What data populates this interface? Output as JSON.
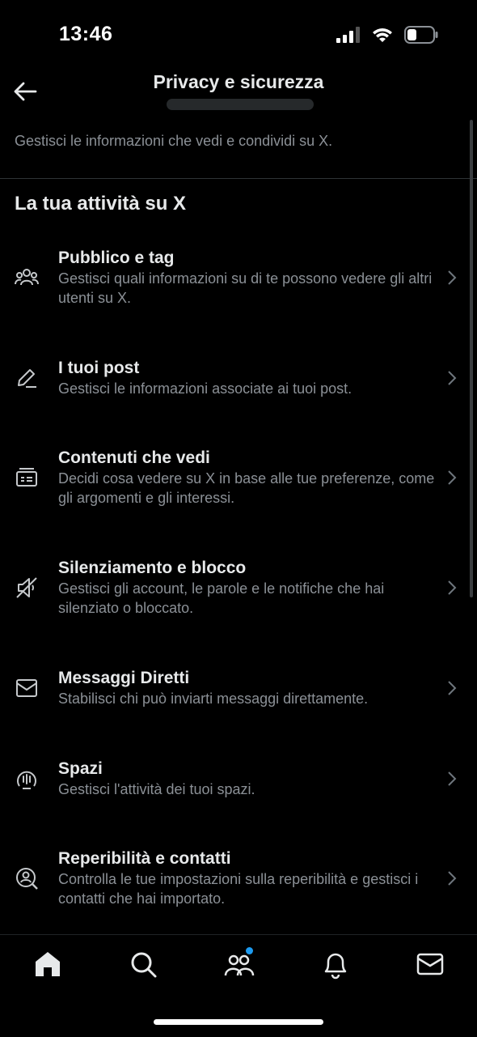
{
  "status_bar": {
    "time": "13:46"
  },
  "header": {
    "title": "Privacy e sicurezza"
  },
  "intro": "Gestisci le informazioni che vedi e condividi su X.",
  "section_title": "La tua attività su X",
  "items": [
    {
      "label": "Pubblico e tag",
      "desc": "Gestisci quali informazioni su di te possono vedere gli altri utenti su X.",
      "icon": "people-icon"
    },
    {
      "label": "I tuoi post",
      "desc": "Gestisci le informazioni associate ai tuoi post.",
      "icon": "pencil-icon"
    },
    {
      "label": "Contenuti che vedi",
      "desc": "Decidi cosa vedere su X in base alle tue preferenze, come gli argomenti e gli interessi.",
      "icon": "feed-icon"
    },
    {
      "label": "Silenziamento e blocco",
      "desc": "Gestisci gli account, le parole e le notifiche che hai silenziato o bloccato.",
      "icon": "mute-icon"
    },
    {
      "label": "Messaggi Diretti",
      "desc": "Stabilisci chi può inviarti messaggi direttamente.",
      "icon": "envelope-icon"
    },
    {
      "label": "Spazi",
      "desc": "Gestisci l'attività dei tuoi spazi.",
      "icon": "spaces-icon"
    },
    {
      "label": "Reperibilità e contatti",
      "desc": "Controlla le tue impostazioni sulla reperibilità e gestisci i contatti che hai importato.",
      "icon": "contact-search-icon"
    }
  ],
  "tabs": [
    "home-icon",
    "search-icon",
    "communities-icon",
    "bell-icon",
    "mail-icon"
  ],
  "colors": {
    "background": "#000000",
    "text": "#e7e9ea",
    "secondary": "#8b9096",
    "accent": "#1d9bf0"
  }
}
